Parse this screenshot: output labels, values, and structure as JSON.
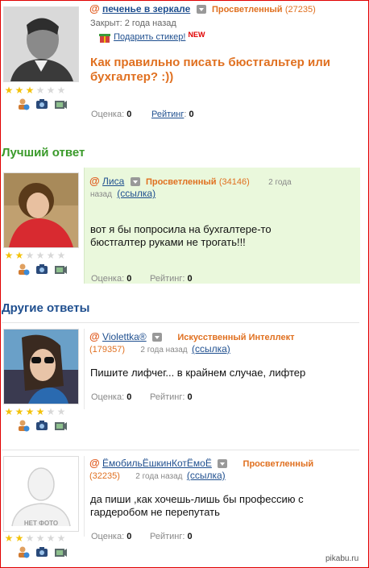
{
  "question": {
    "author": "печенье в зеркале",
    "rank": "Просветленный",
    "rank_points": "(27235)",
    "status": "Закрыт: 2 года назад",
    "gift_link": "Подарить стикер!",
    "gift_badge": "NEW",
    "title_line1": "Как правильно писать бюстгальтер или",
    "title_line2": "бухгалтер? :))",
    "score_label": "Оценка:",
    "score_value": "0",
    "rating_label": "Рейтинг",
    "rating_value": "0",
    "stars_on": 3
  },
  "best_answer": {
    "section_title": "Лучший ответ",
    "author": "Лиса",
    "rank": "Просветленный",
    "rank_points": "(34146)",
    "time_part1": "2 года",
    "time_part2": "назад",
    "link": "(ссылка)",
    "text_line1": "вот я бы попросила на бухгалтере-то",
    "text_line2": "бюстгалтер руками не трогать!!!",
    "score_label": "Оценка:",
    "score_value": "0",
    "rating_label": "Рейтинг:",
    "rating_value": "0",
    "stars_on": 2
  },
  "other_answers_title": "Другие ответы",
  "answers": [
    {
      "author": "Violettka®",
      "rank": "Искусственный Интеллект",
      "rank_points": "(179357)",
      "time": "2 года назад",
      "link": "(ссылка)",
      "text_line1": "Пишите лифчег... в крайнем случае, лифтер",
      "score_label": "Оценка:",
      "score_value": "0",
      "rating_label": "Рейтинг:",
      "rating_value": "0",
      "stars_on": 4
    },
    {
      "author": "ЁмобильЁшкинКотЁмоЁ",
      "rank": "Просветленный",
      "rank_points": "(32235)",
      "time": "2 года назад",
      "link": "(ссылка)",
      "text_line1": "да пиши ,как хочешь-лишь бы профессию с",
      "text_line2": "гардеробом не перепутать",
      "no_photo": "НЕТ ФОТО",
      "score_label": "Оценка:",
      "score_value": "0",
      "rating_label": "Рейтинг:",
      "rating_value": "0",
      "stars_on": 2
    }
  ],
  "watermark": "pikabu.ru"
}
